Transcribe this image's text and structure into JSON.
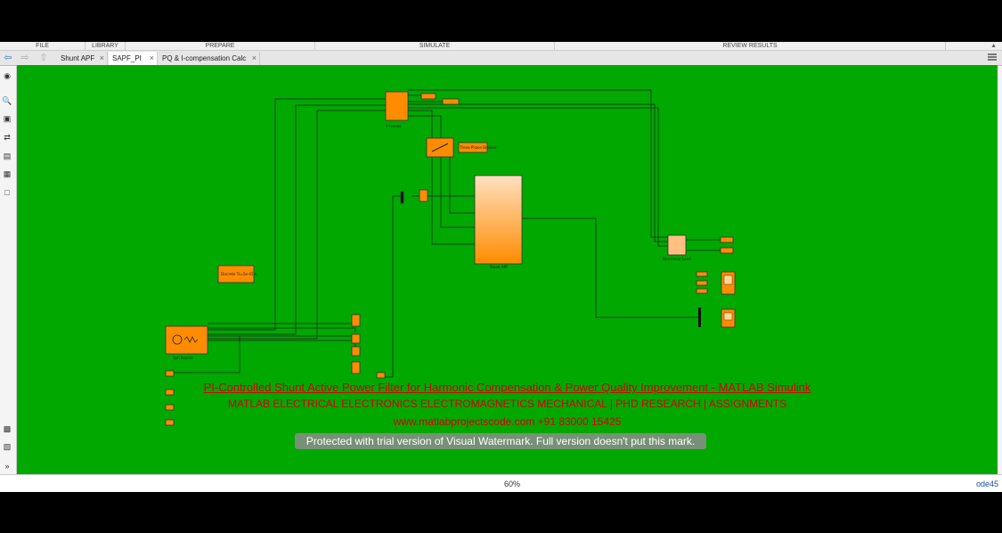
{
  "toolstrip": {
    "sections": [
      "FILE",
      "LIBRARY",
      "PREPARE",
      "SIMULATE",
      "REVIEW RESULTS"
    ]
  },
  "tabs": [
    {
      "label": "Shunt APF",
      "active": false
    },
    {
      "label": "SAPF_PI",
      "active": true
    },
    {
      "label": "PQ & I-compensation Calc",
      "active": false
    }
  ],
  "palette": {
    "icons": [
      "hide-show-icon",
      "zoom-icon",
      "fit-view-icon",
      "arrow-icon",
      "annotation-icon",
      "image-icon",
      "area-icon",
      "camera-icon",
      "model-browser-icon",
      "expand-icon"
    ]
  },
  "model": {
    "blocks": {
      "vi_meas": "V-I meas",
      "breaker": "Three-Phase Breaker",
      "shunt_apf": "Shunt APF",
      "nonlinear": "Non-linear Load",
      "powergui": "Discrete Ts=5e-05 s.",
      "source": "3ph Source"
    },
    "watermark": {
      "line1": "PI-Controlled Shunt Active Power Filter for Harmonic Compensation & Power Quality Improvement - MATLAB Simulink",
      "line2": "MATLAB ELECTRICAL ELECTRONICS ELECTROMAGNETICS MECHANICAL | PHD RESEARCH | ASSIGNMENTS",
      "line3": "www.matlabprojectscode.com +91 83000 15425"
    }
  },
  "statusbar": {
    "zoom": "60%",
    "solver": "ode45"
  },
  "trial_notice": "Protected with trial version of Visual Watermark. Full version doesn't put this mark."
}
